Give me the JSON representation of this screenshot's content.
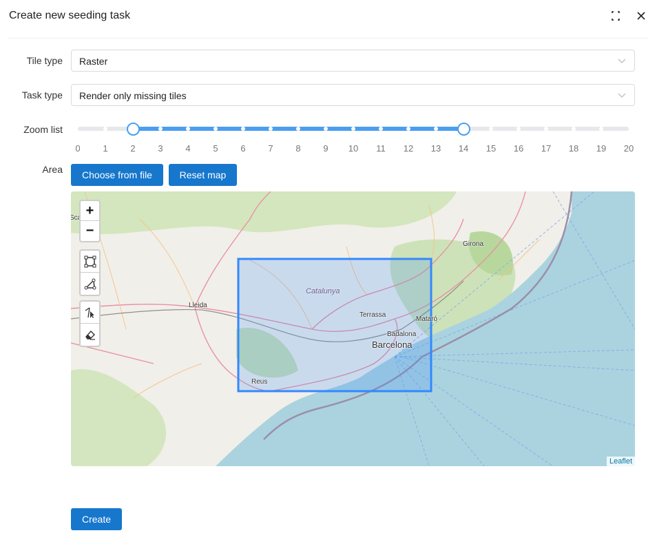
{
  "dialog": {
    "title": "Create new seeding task"
  },
  "form": {
    "tile_type": {
      "label": "Tile type",
      "value": "Raster"
    },
    "task_type": {
      "label": "Task type",
      "value": "Render only missing tiles"
    },
    "zoom": {
      "label": "Zoom list",
      "min": 0,
      "max": 20,
      "selected_from": 2,
      "selected_to": 14,
      "ticks": [
        "0",
        "1",
        "2",
        "3",
        "4",
        "5",
        "6",
        "7",
        "8",
        "9",
        "10",
        "11",
        "12",
        "13",
        "14",
        "15",
        "16",
        "17",
        "18",
        "19",
        "20"
      ]
    },
    "area": {
      "label": "Area",
      "choose_file_label": "Choose from file",
      "reset_map_label": "Reset map"
    },
    "create_label": "Create"
  },
  "map": {
    "zoom_in": "+",
    "zoom_out": "−",
    "attribution": "Leaflet",
    "cities": {
      "girona": "Girona",
      "lleida": "Lleida",
      "terrassa": "Terrassa",
      "mataro": "Mataró",
      "badalona": "Badalona",
      "barcelona": "Barcelona",
      "reus": "Reus",
      "edge": "Sca"
    },
    "region": "Catalunya"
  },
  "colors": {
    "primary": "#1677cc",
    "slider": "#4a9ef0",
    "sea": "#aad3df",
    "selection": "#3388ff"
  }
}
